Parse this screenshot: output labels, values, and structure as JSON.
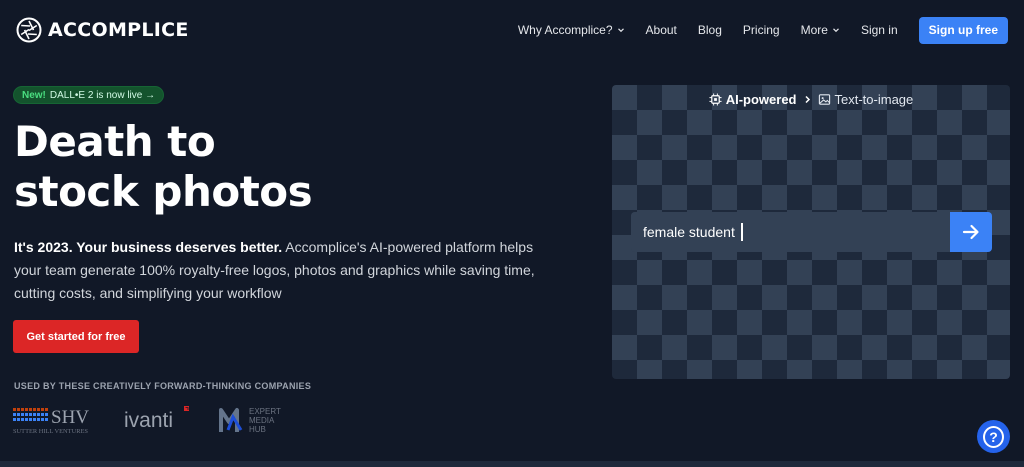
{
  "brand": {
    "name": "ACCOMPLICE"
  },
  "nav": {
    "items": [
      {
        "label": "Why Accomplice?",
        "has_dropdown": true
      },
      {
        "label": "About",
        "has_dropdown": false
      },
      {
        "label": "Blog",
        "has_dropdown": false
      },
      {
        "label": "Pricing",
        "has_dropdown": false
      },
      {
        "label": "More",
        "has_dropdown": true
      },
      {
        "label": "Sign in",
        "has_dropdown": false
      }
    ],
    "signup_label": "Sign up free"
  },
  "hero": {
    "badge_new": "New!",
    "badge_text": "DALL•E 2 is now live →",
    "title_line1": "Death to",
    "title_line2": "stock photos",
    "desc_strong": "It's 2023. Your business deserves better.",
    "desc_rest": " Accomplice's AI-powered platform helps your team generate 100% royalty-free logos, photos and graphics while saving time, cutting costs, and simplifying your workflow",
    "cta_label": "Get started for free",
    "used_by": "USED BY THESE CREATIVELY FORWARD-THINKING COMPANIES",
    "companies": {
      "shv": "SHV",
      "shv_sub": "SUTTER HILL VENTURES",
      "ivanti": "ivanti",
      "emh_1": "EXPERT",
      "emh_2": "MEDIA",
      "emh_3": "HUB"
    }
  },
  "demo": {
    "crumb1": "AI-powered",
    "crumb2": "Text-to-image",
    "prompt_value": "female student"
  },
  "help": {
    "label": "?"
  },
  "colors": {
    "background": "#111827",
    "primary_blue": "#3b82f6",
    "cta_red": "#dc2626",
    "badge_green": "#14532d"
  },
  "icons": {
    "logo": "aperture-logo-icon",
    "chevron": "chevron-down-icon",
    "chip": "cpu-chip-icon",
    "breadcrumb": "chevron-right-icon",
    "image": "image-icon",
    "submit": "arrow-right-icon",
    "help": "question-mark-icon"
  }
}
